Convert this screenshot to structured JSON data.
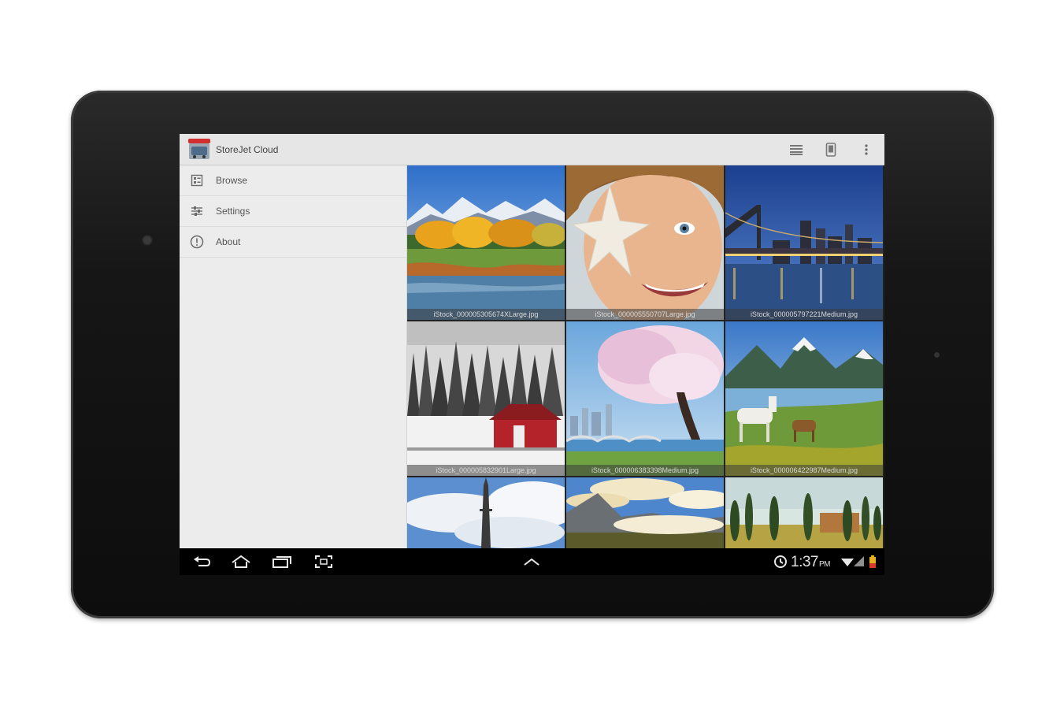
{
  "app": {
    "title": "StoreJet Cloud",
    "accent_color": "#d32f2f"
  },
  "actionbar": {
    "icons": [
      "list-view-icon",
      "phone-device-icon",
      "overflow-menu-icon"
    ]
  },
  "drawer": {
    "items": [
      {
        "label": "Browse",
        "icon": "browse-icon"
      },
      {
        "label": "Settings",
        "icon": "settings-icon"
      },
      {
        "label": "About",
        "icon": "info-icon"
      }
    ]
  },
  "gallery": {
    "tiles": [
      {
        "caption": "iStock_000005305674XLarge.jpg",
        "scene": "autumn-lake"
      },
      {
        "caption": "iStock_000005550707Large.jpg",
        "scene": "child-starfish"
      },
      {
        "caption": "iStock_000005797221Medium.jpg",
        "scene": "city-bridge-night"
      },
      {
        "caption": "iStock_000005832901Large.jpg",
        "scene": "snowy-barn"
      },
      {
        "caption": "iStock_000006383398Medium.jpg",
        "scene": "blossom-tree-city"
      },
      {
        "caption": "iStock_000006422987Medium.jpg",
        "scene": "horses-mountain-lake"
      },
      {
        "caption": "",
        "scene": "eiffel-tower-sky"
      },
      {
        "caption": "",
        "scene": "mountain-valley-clouds"
      },
      {
        "caption": "",
        "scene": "cypress-hills"
      }
    ]
  },
  "statusbar": {
    "time": "1:37",
    "ampm": "PM"
  }
}
